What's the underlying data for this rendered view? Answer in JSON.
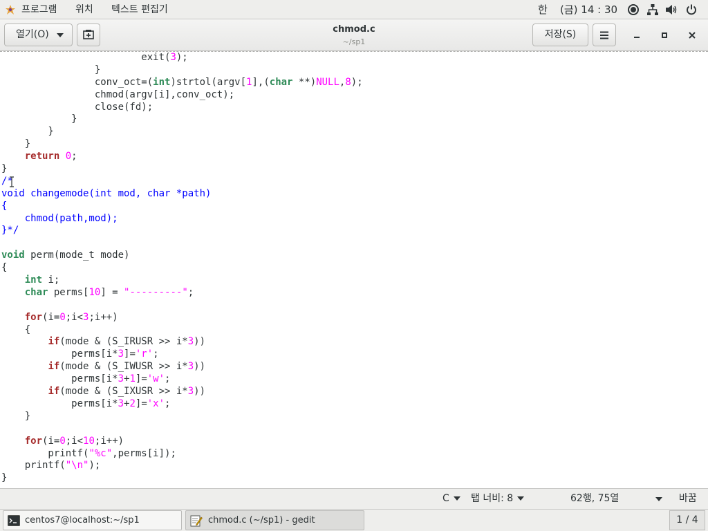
{
  "topbar": {
    "apps_menu": "프로그램",
    "places_menu": "위치",
    "app_menu": "텍스트 편집기",
    "input_method": "한",
    "clock": "(금) 14 : 30"
  },
  "headerbar": {
    "open_label": "열기(O)",
    "title": "chmod.c",
    "subtitle": "~/sp1",
    "save_label": "저장(S)"
  },
  "editor": {
    "lines": [
      [
        [
          "            exit(",
          ""
        ],
        [
          "3",
          "num"
        ],
        [
          ");",
          ""
        ]
      ],
      [
        [
          "        }",
          ""
        ]
      ],
      [
        [
          "        conv_oct=(",
          ""
        ],
        [
          "int",
          "ty"
        ],
        [
          ")strtol(argv[",
          ""
        ],
        [
          "1",
          "num"
        ],
        [
          "],(",
          ""
        ],
        [
          "char",
          "ty"
        ],
        [
          " **)",
          ""
        ],
        [
          "NULL",
          "num"
        ],
        [
          ",",
          ""
        ],
        [
          "8",
          "num"
        ],
        [
          ");",
          ""
        ]
      ],
      [
        [
          "        chmod(argv[i],conv_oct);",
          ""
        ]
      ],
      [
        [
          "        close(fd);",
          ""
        ]
      ],
      [
        [
          "      }",
          ""
        ]
      ],
      [
        [
          "    }",
          ""
        ]
      ],
      [
        [
          "  }",
          ""
        ]
      ],
      [
        [
          "  ",
          ""
        ],
        [
          "return",
          "kw"
        ],
        [
          " ",
          ""
        ],
        [
          "0",
          "num"
        ],
        [
          ";",
          ""
        ]
      ],
      [
        [
          "}",
          ""
        ]
      ],
      [
        [
          "/*",
          "cm"
        ]
      ],
      [
        [
          "void changemode(int mod, char *path)",
          "cm"
        ]
      ],
      [
        [
          "{",
          "cm"
        ]
      ],
      [
        [
          "  chmod(path,mod);",
          "cm"
        ]
      ],
      [
        [
          "}*/",
          "cm"
        ]
      ],
      [
        [
          "",
          ""
        ]
      ],
      [
        [
          "void",
          "ty"
        ],
        [
          " perm(mode_t mode)",
          ""
        ]
      ],
      [
        [
          "{",
          ""
        ]
      ],
      [
        [
          "  ",
          ""
        ],
        [
          "int",
          "ty"
        ],
        [
          " i;",
          ""
        ]
      ],
      [
        [
          "  ",
          ""
        ],
        [
          "char",
          "ty"
        ],
        [
          " perms[",
          ""
        ],
        [
          "10",
          "num"
        ],
        [
          "] = ",
          ""
        ],
        [
          "\"---------\"",
          "str"
        ],
        [
          ";",
          ""
        ]
      ],
      [
        [
          "",
          ""
        ]
      ],
      [
        [
          "  ",
          ""
        ],
        [
          "for",
          "kw"
        ],
        [
          "(i=",
          ""
        ],
        [
          "0",
          "num"
        ],
        [
          ";i<",
          ""
        ],
        [
          "3",
          "num"
        ],
        [
          ";i++)",
          ""
        ]
      ],
      [
        [
          "  {",
          ""
        ]
      ],
      [
        [
          "    ",
          ""
        ],
        [
          "if",
          "kw"
        ],
        [
          "(mode & (S_IRUSR >> i*",
          ""
        ],
        [
          "3",
          "num"
        ],
        [
          "))",
          ""
        ]
      ],
      [
        [
          "      perms[i*",
          ""
        ],
        [
          "3",
          "num"
        ],
        [
          "]=",
          ""
        ],
        [
          "'r'",
          "str"
        ],
        [
          ";",
          ""
        ]
      ],
      [
        [
          "    ",
          ""
        ],
        [
          "if",
          "kw"
        ],
        [
          "(mode & (S_IWUSR >> i*",
          ""
        ],
        [
          "3",
          "num"
        ],
        [
          "))",
          ""
        ]
      ],
      [
        [
          "      perms[i*",
          ""
        ],
        [
          "3",
          "num"
        ],
        [
          "+",
          ""
        ],
        [
          "1",
          "num"
        ],
        [
          "]=",
          ""
        ],
        [
          "'w'",
          "str"
        ],
        [
          ";",
          ""
        ]
      ],
      [
        [
          "    ",
          ""
        ],
        [
          "if",
          "kw"
        ],
        [
          "(mode & (S_IXUSR >> i*",
          ""
        ],
        [
          "3",
          "num"
        ],
        [
          "))",
          ""
        ]
      ],
      [
        [
          "      perms[i*",
          ""
        ],
        [
          "3",
          "num"
        ],
        [
          "+",
          ""
        ],
        [
          "2",
          "num"
        ],
        [
          "]=",
          ""
        ],
        [
          "'x'",
          "str"
        ],
        [
          ";",
          ""
        ]
      ],
      [
        [
          "  }",
          ""
        ]
      ],
      [
        [
          "",
          ""
        ]
      ],
      [
        [
          "  ",
          ""
        ],
        [
          "for",
          "kw"
        ],
        [
          "(i=",
          ""
        ],
        [
          "0",
          "num"
        ],
        [
          ";i<",
          ""
        ],
        [
          "10",
          "num"
        ],
        [
          ";i++)",
          ""
        ]
      ],
      [
        [
          "    printf(",
          ""
        ],
        [
          "\"%c\"",
          "str"
        ],
        [
          ",perms[i]);",
          ""
        ]
      ],
      [
        [
          "  printf(",
          ""
        ],
        [
          "\"\\n\"",
          "str"
        ],
        [
          ");",
          ""
        ]
      ],
      [
        [
          "}",
          ""
        ]
      ]
    ]
  },
  "statusbar": {
    "language": "C",
    "tab_width": "탭 너비: 8",
    "cursor_pos": "62행, 75열",
    "mode": "바꿈"
  },
  "taskbar": {
    "terminal_task": "centos7@localhost:~/sp1",
    "gedit_task": "chmod.c (~/sp1) - gedit",
    "workspace": "1 / 4"
  },
  "icons": {
    "apps": "apps-icon",
    "record": "record-icon",
    "network": "network-icon",
    "volume": "volume-icon",
    "power": "power-icon",
    "new_tab": "new-tab-icon",
    "hamburger": "hamburger-menu-icon",
    "minimize": "minimize-icon",
    "maximize": "maximize-icon",
    "close": "close-icon",
    "terminal": "terminal-icon",
    "gedit": "gedit-icon"
  }
}
